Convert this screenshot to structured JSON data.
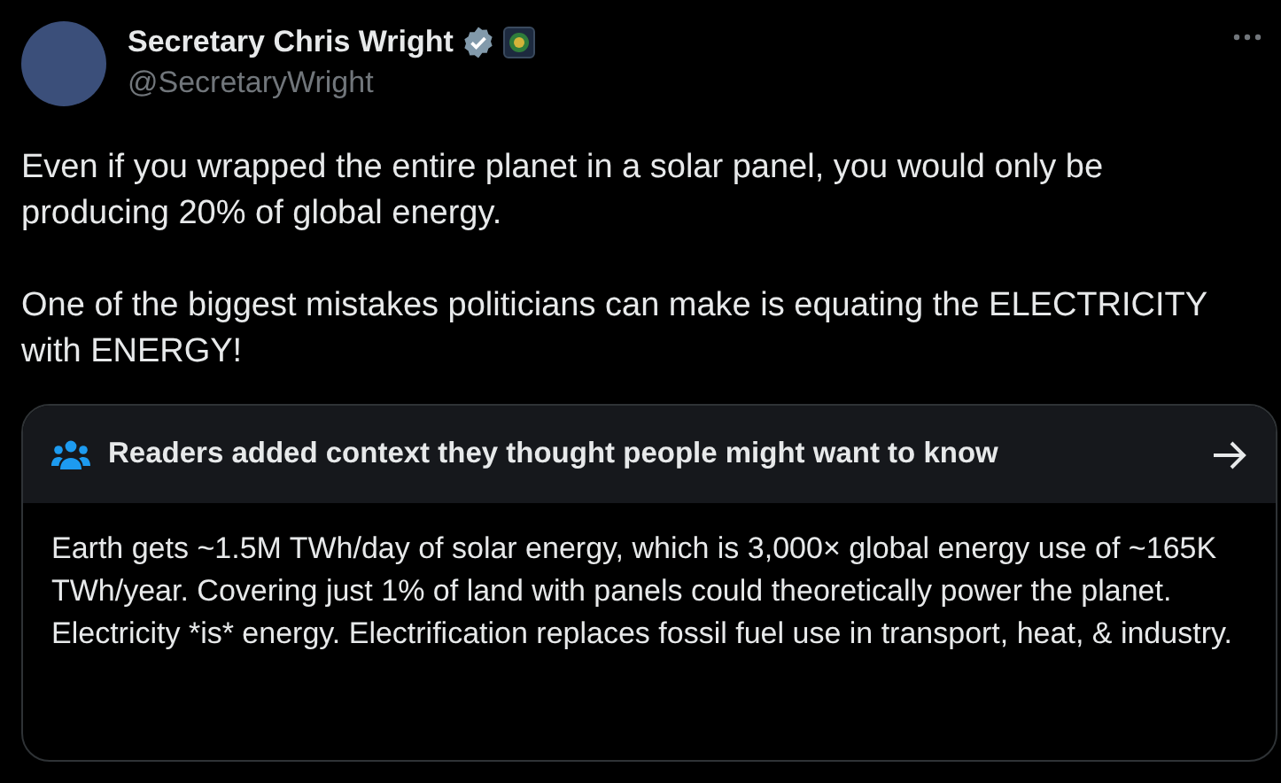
{
  "author": {
    "name": "Secretary Chris Wright",
    "verified": true,
    "handle": "@SecretaryWright"
  },
  "paragraphs": [
    "Even if you wrapped the entire planet in a solar panel, you would only be producing 20% of global energy.",
    "One of the biggest mistakes politicians can make is equating the ELECTRICITY with ENERGY!"
  ],
  "community_note": {
    "title": "Readers added context they thought people might want to know",
    "text": "Earth gets ~1.5M TWh/day of solar energy, which is 3,000× global energy use of ~165K TWh/year. Covering just 1% of land with panels could theoretically power the planet. Electricity *is* energy. Electrification replaces fossil fuel use in transport, heat, & industry."
  }
}
